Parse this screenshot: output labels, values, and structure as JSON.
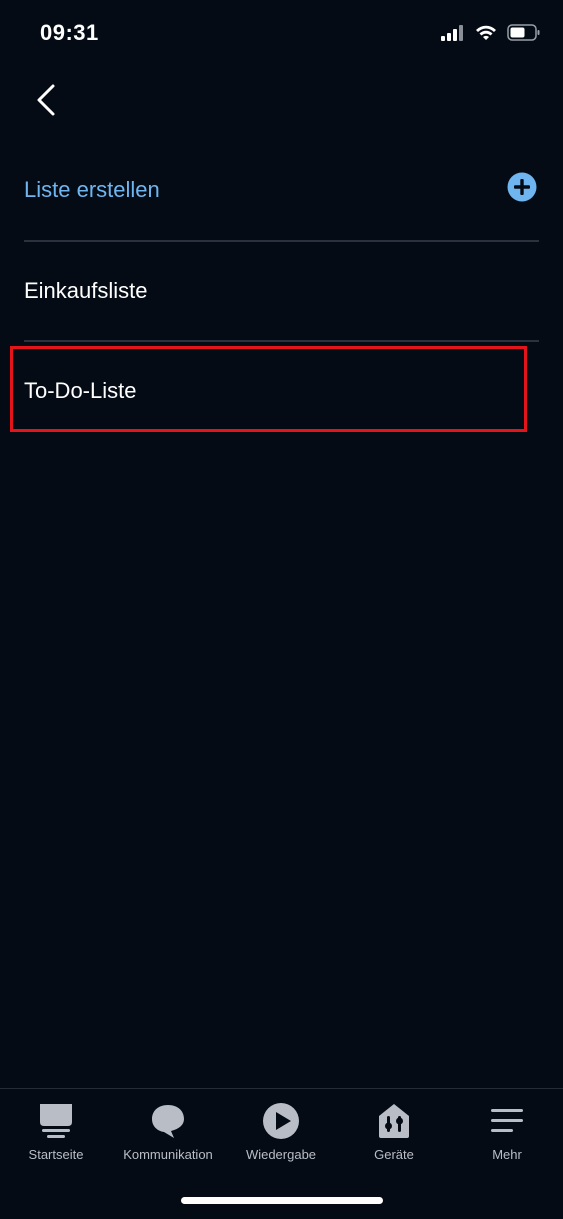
{
  "status_bar": {
    "time": "09:31",
    "signal_icon": "signal-icon",
    "wifi_icon": "wifi-icon",
    "battery_icon": "battery-icon"
  },
  "header": {
    "back_icon": "chevron-left-icon"
  },
  "create_list": {
    "label": "Liste erstellen",
    "icon": "plus-circle-icon",
    "color": "#6fb6f0"
  },
  "lists": [
    {
      "label": "Einkaufsliste"
    },
    {
      "label": "To-Do-Liste",
      "highlighted": true
    }
  ],
  "highlight_color": "#e3151b",
  "bottom_nav": [
    {
      "label": "Startseite",
      "icon": "home-icon"
    },
    {
      "label": "Kommunikation",
      "icon": "chat-bubble-icon"
    },
    {
      "label": "Wiedergabe",
      "icon": "play-icon"
    },
    {
      "label": "Geräte",
      "icon": "devices-icon"
    },
    {
      "label": "Mehr",
      "icon": "menu-icon"
    }
  ]
}
